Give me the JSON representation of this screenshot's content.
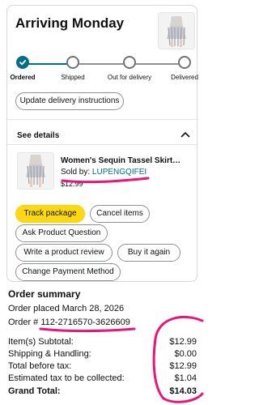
{
  "shipment": {
    "heading": "Arriving Monday",
    "timeline": [
      {
        "label": "Ordered",
        "state": "done"
      },
      {
        "label": "Shipped",
        "state": "pending"
      },
      {
        "label": "Out for delivery",
        "state": "pending"
      },
      {
        "label": "Delivered",
        "state": "pending"
      }
    ],
    "update_button": "Update delivery instructions"
  },
  "details": {
    "label": "See details",
    "expanded": true
  },
  "item": {
    "title": "Women's Sequin Tassel Skirt…",
    "sold_by_prefix": "Sold by: ",
    "seller": "LUPENGQIFEI",
    "price": "$12.99"
  },
  "actions": {
    "track": "Track package",
    "cancel": "Cancel items",
    "ask": "Ask Product Question",
    "review": "Write a product review",
    "buy_again": "Buy it again",
    "payment": "Change Payment Method"
  },
  "summary": {
    "title": "Order summary",
    "placed": "Order placed March 28, 2026",
    "order_prefix": "Order # ",
    "order_number": "112-2716570-3626609",
    "rows": [
      {
        "label": "Item(s) Subtotal:",
        "value": "$12.99"
      },
      {
        "label": "Shipping & Handling:",
        "value": "$0.00"
      },
      {
        "label": "Total before tax:",
        "value": "$12.99"
      },
      {
        "label": "Estimated tax to be collected:",
        "value": "$1.04"
      },
      {
        "label": "Grand Total:",
        "value": "$14.03"
      }
    ]
  },
  "colors": {
    "accent": "#007185",
    "primary_button": "#ffd814",
    "annotation": "#e8157a"
  },
  "icons": {
    "check": "check-icon",
    "chevron": "chevron-up-icon",
    "product": "skirt-image"
  }
}
